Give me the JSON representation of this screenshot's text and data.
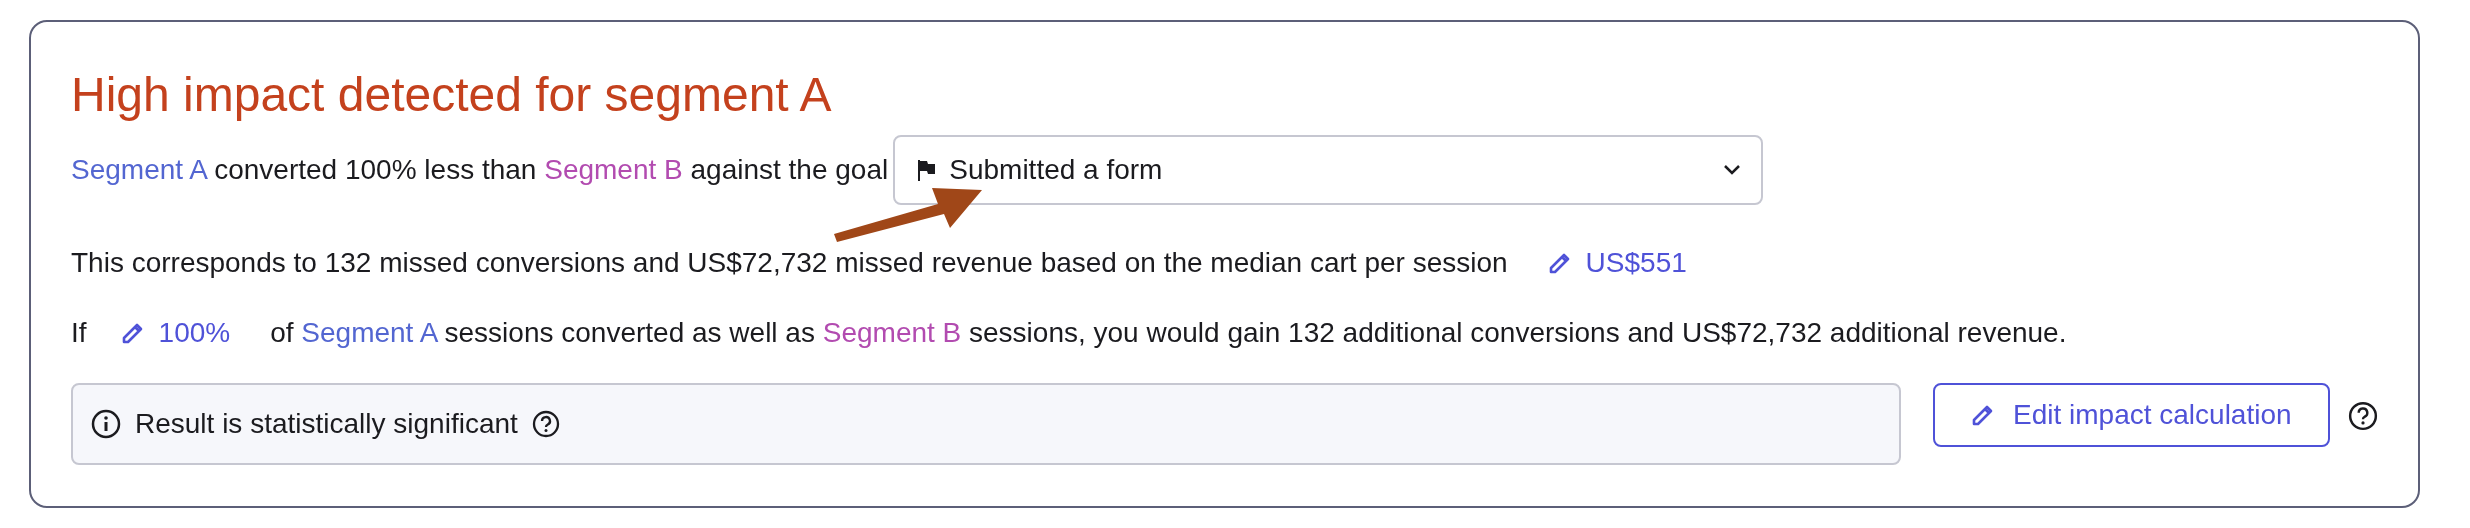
{
  "title": "High impact detected for segment A",
  "goal_sentence": {
    "parts": [
      {
        "kind": "segment",
        "text": "Segment A",
        "color": "#5366d1"
      },
      {
        "kind": "text",
        "text": " converted 100% less than "
      },
      {
        "kind": "segment",
        "text": "Segment B",
        "color": "#b24bb0"
      },
      {
        "kind": "text",
        "text": " against the goal"
      }
    ],
    "goal_dropdown": {
      "value": "Submitted a form"
    }
  },
  "missed_sentence": {
    "text": "This corresponds to 132 missed conversions and US$72,732 missed revenue based on the median cart per session",
    "edit_value": "US$551"
  },
  "gain_sentence": {
    "lead": "If",
    "edit_value": "100%",
    "parts": [
      {
        "kind": "text",
        "text": "of "
      },
      {
        "kind": "segment",
        "text": "Segment A",
        "color": "#5366d1"
      },
      {
        "kind": "text",
        "text": " sessions converted as well as "
      },
      {
        "kind": "segment",
        "text": "Segment B",
        "color": "#b24bb0"
      },
      {
        "kind": "text",
        "text": " sessions, you would gain 132 additional conversions and US$72,732 additional revenue."
      }
    ]
  },
  "significance": {
    "text": "Result is statistically significant"
  },
  "edit_button": {
    "label": "Edit impact calculation"
  },
  "annotation": {
    "kind": "arrow"
  }
}
